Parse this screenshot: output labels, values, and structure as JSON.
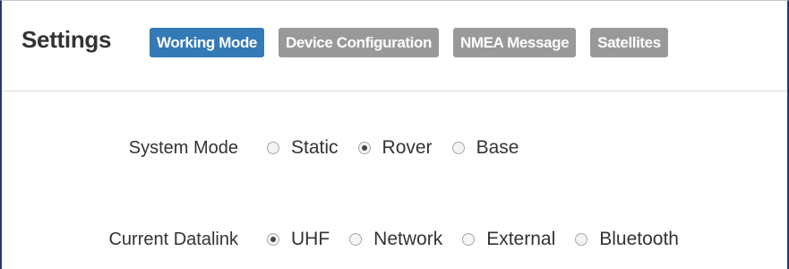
{
  "header": {
    "title": "Settings",
    "tabs": [
      {
        "label": "Working Mode",
        "active": true
      },
      {
        "label": "Device Configuration",
        "active": false
      },
      {
        "label": "NMEA Message",
        "active": false
      },
      {
        "label": "Satellites",
        "active": false
      }
    ]
  },
  "form": {
    "system_mode": {
      "label": "System Mode",
      "selected": "Rover",
      "options": [
        {
          "label": "Static",
          "checked": false
        },
        {
          "label": "Rover",
          "checked": true
        },
        {
          "label": "Base",
          "checked": false
        }
      ]
    },
    "current_datalink": {
      "label": "Current Datalink",
      "selected": "UHF",
      "options": [
        {
          "label": "UHF",
          "checked": true
        },
        {
          "label": "Network",
          "checked": false
        },
        {
          "label": "External",
          "checked": false
        },
        {
          "label": "Bluetooth",
          "checked": false
        }
      ]
    }
  },
  "colors": {
    "active_tab": "#337ab7",
    "inactive_tab": "#999999",
    "frame_border": "#1f3a73"
  }
}
